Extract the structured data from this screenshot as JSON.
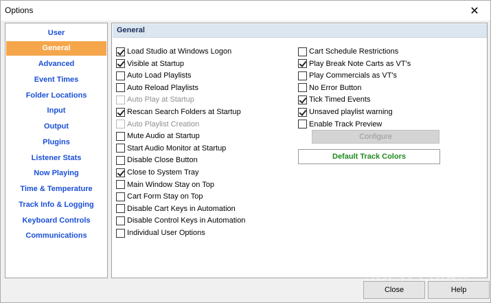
{
  "window": {
    "title": "Options"
  },
  "sidebar": {
    "items": [
      {
        "label": "User"
      },
      {
        "label": "General"
      },
      {
        "label": "Advanced"
      },
      {
        "label": "Event Times"
      },
      {
        "label": "Folder Locations"
      },
      {
        "label": "Input"
      },
      {
        "label": "Output"
      },
      {
        "label": "Plugins"
      },
      {
        "label": "Listener Stats"
      },
      {
        "label": "Now Playing"
      },
      {
        "label": "Time & Temperature"
      },
      {
        "label": "Track Info & Logging"
      },
      {
        "label": "Keyboard Controls"
      },
      {
        "label": "Communications"
      }
    ],
    "selected": "General"
  },
  "main": {
    "section_title": "General",
    "left_options": [
      {
        "label": "Load Studio at Windows Logon",
        "checked": true,
        "enabled": true
      },
      {
        "label": "Visible at Startup",
        "checked": true,
        "enabled": true
      },
      {
        "label": "Auto Load Playlists",
        "checked": false,
        "enabled": true
      },
      {
        "label": "Auto Reload Playlists",
        "checked": false,
        "enabled": true
      },
      {
        "label": "Auto Play at Startup",
        "checked": false,
        "enabled": false
      },
      {
        "label": "Rescan Search Folders at Startup",
        "checked": true,
        "enabled": true
      },
      {
        "label": "Auto Playlist Creation",
        "checked": false,
        "enabled": false
      },
      {
        "label": "Mute Audio at Startup",
        "checked": false,
        "enabled": true
      },
      {
        "label": "Start Audio Monitor at Startup",
        "checked": false,
        "enabled": true
      },
      {
        "label": "Disable Close Button",
        "checked": false,
        "enabled": true
      },
      {
        "label": "Close to System Tray",
        "checked": true,
        "enabled": true
      },
      {
        "label": "Main Window Stay on Top",
        "checked": false,
        "enabled": true
      },
      {
        "label": "Cart Form Stay on Top",
        "checked": false,
        "enabled": true
      },
      {
        "label": "Disable Cart Keys in Automation",
        "checked": false,
        "enabled": true
      },
      {
        "label": "Disable Control Keys in Automation",
        "checked": false,
        "enabled": true
      },
      {
        "label": "Individual User Options",
        "checked": false,
        "enabled": true
      }
    ],
    "right_options": [
      {
        "label": "Cart Schedule Restrictions",
        "checked": false,
        "enabled": true
      },
      {
        "label": "Play Break Note Carts as VT's",
        "checked": true,
        "enabled": true
      },
      {
        "label": "Play Commercials as VT's",
        "checked": false,
        "enabled": true
      },
      {
        "label": "No Error Button",
        "checked": false,
        "enabled": true
      },
      {
        "label": "Tick Timed Events",
        "checked": true,
        "enabled": true
      },
      {
        "label": "Unsaved playlist warning",
        "checked": true,
        "enabled": true
      },
      {
        "label": "Enable Track Preview",
        "checked": false,
        "enabled": true
      }
    ],
    "configure_label": "Configure",
    "default_colors_label": "Default Track Colors"
  },
  "footer": {
    "close_label": "Close",
    "help_label": "Help"
  },
  "watermark": "SOFTPEDIA®",
  "colors": {
    "accent_selected": "#f5a64b",
    "sidebar_link": "#1a4fd6",
    "header_bg": "#dbe6f0",
    "default_colors_text": "#1f8a1f"
  }
}
